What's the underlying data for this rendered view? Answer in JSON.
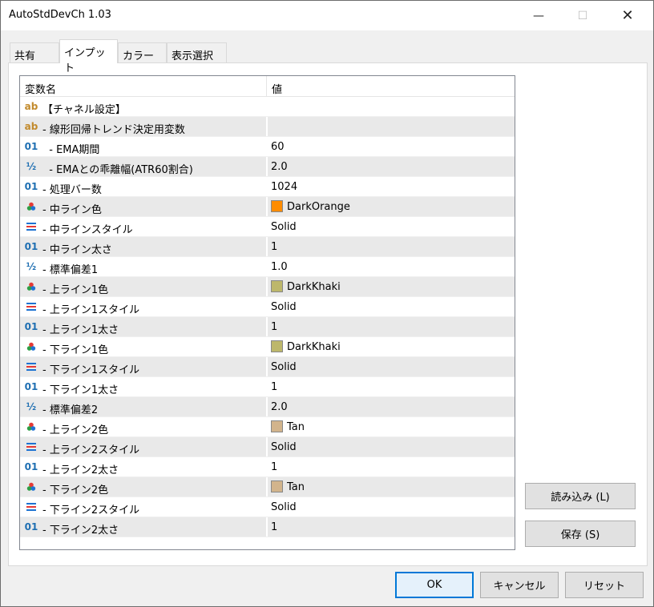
{
  "window": {
    "title": "AutoStdDevCh 1.03"
  },
  "tabs": [
    {
      "label": "共有"
    },
    {
      "label": "インプット"
    },
    {
      "label": "カラー"
    },
    {
      "label": "表示選択"
    }
  ],
  "table": {
    "headers": {
      "name": "変数名",
      "value": "値"
    },
    "rows": [
      {
        "icon": "ab",
        "name": "【チャネル設定】",
        "value": ""
      },
      {
        "icon": "ab",
        "name": "- 線形回帰トレンド決定用変数",
        "value": ""
      },
      {
        "icon": "01",
        "name": "  - EMA期間",
        "value": "60"
      },
      {
        "icon": "half",
        "name": "  - EMAとの乖離幅(ATR60割合)",
        "value": "2.0"
      },
      {
        "icon": "01",
        "name": "- 処理バー数",
        "value": "1024"
      },
      {
        "icon": "color",
        "name": "- 中ライン色",
        "value": "DarkOrange",
        "swatch": "#ff8c00"
      },
      {
        "icon": "style",
        "name": "- 中ラインスタイル",
        "value": "Solid"
      },
      {
        "icon": "01",
        "name": "- 中ライン太さ",
        "value": "1"
      },
      {
        "icon": "half",
        "name": "- 標準偏差1",
        "value": "1.0"
      },
      {
        "icon": "color",
        "name": "- 上ライン1色",
        "value": "DarkKhaki",
        "swatch": "#bdb76b"
      },
      {
        "icon": "style",
        "name": "- 上ライン1スタイル",
        "value": "Solid"
      },
      {
        "icon": "01",
        "name": "- 上ライン1太さ",
        "value": "1"
      },
      {
        "icon": "color",
        "name": "- 下ライン1色",
        "value": "DarkKhaki",
        "swatch": "#bdb76b"
      },
      {
        "icon": "style",
        "name": "- 下ライン1スタイル",
        "value": "Solid"
      },
      {
        "icon": "01",
        "name": "- 下ライン1太さ",
        "value": "1"
      },
      {
        "icon": "half",
        "name": "- 標準偏差2",
        "value": "2.0"
      },
      {
        "icon": "color",
        "name": "- 上ライン2色",
        "value": "Tan",
        "swatch": "#d2b48c"
      },
      {
        "icon": "style",
        "name": "- 上ライン2スタイル",
        "value": "Solid"
      },
      {
        "icon": "01",
        "name": "- 上ライン2太さ",
        "value": "1"
      },
      {
        "icon": "color",
        "name": "- 下ライン2色",
        "value": "Tan",
        "swatch": "#d2b48c"
      },
      {
        "icon": "style",
        "name": "- 下ライン2スタイル",
        "value": "Solid"
      },
      {
        "icon": "01",
        "name": "- 下ライン2太さ",
        "value": "1"
      }
    ]
  },
  "side_buttons": {
    "load": "読み込み (L)",
    "save": "保存 (S)"
  },
  "footer_buttons": {
    "ok": "OK",
    "cancel": "キャンセル",
    "reset": "リセット"
  },
  "colors": {
    "accent": "#0078d7",
    "row_shade": "#e9e9e9"
  }
}
